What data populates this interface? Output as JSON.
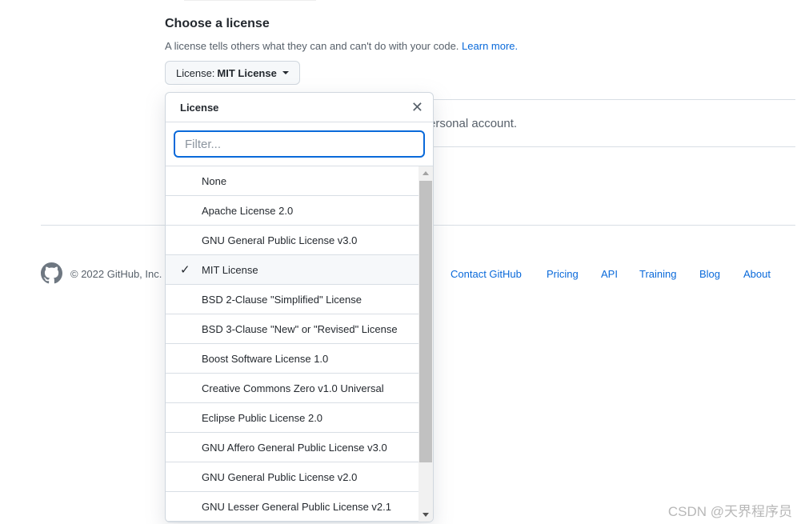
{
  "section": {
    "title": "Choose a license",
    "description": "A license tells others what they can and can't do with your code.",
    "learn_more": "Learn more."
  },
  "license_button": {
    "prefix": "License:",
    "value": "MIT License"
  },
  "background_text": "ersonal account.",
  "dropdown": {
    "title": "License",
    "filter_placeholder": "Filter...",
    "selected": "MIT License",
    "items": [
      "None",
      "Apache License 2.0",
      "GNU General Public License v3.0",
      "MIT License",
      "BSD 2-Clause \"Simplified\" License",
      "BSD 3-Clause \"New\" or \"Revised\" License",
      "Boost Software License 1.0",
      "Creative Commons Zero v1.0 Universal",
      "Eclipse Public License 2.0",
      "GNU Affero General Public License v3.0",
      "GNU General Public License v2.0",
      "GNU Lesser General Public License v2.1"
    ]
  },
  "footer": {
    "copyright": "© 2022 GitHub, Inc.",
    "links": [
      "Contact GitHub",
      "Pricing",
      "API",
      "Training",
      "Blog",
      "About"
    ]
  },
  "watermark": "CSDN @天界程序员",
  "colors": {
    "accent": "#0969da",
    "text": "#24292f",
    "muted": "#57606a"
  }
}
